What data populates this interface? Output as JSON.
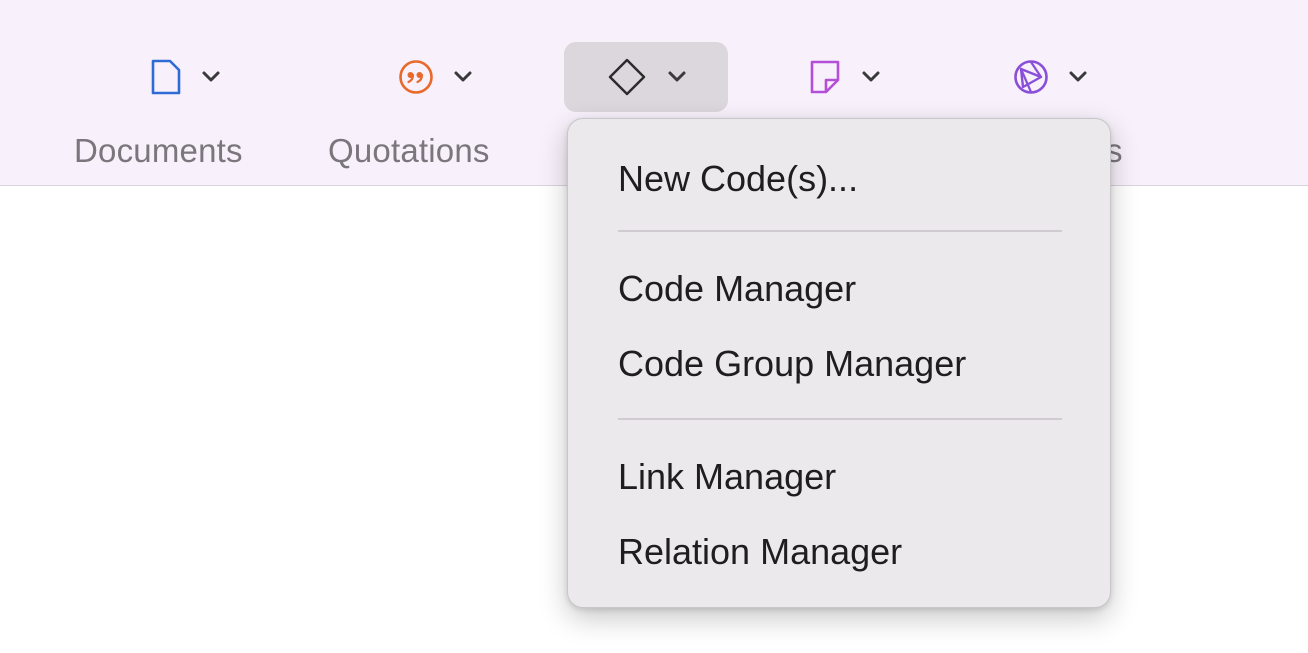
{
  "toolbar": {
    "documents": {
      "label": "Documents",
      "icon": "document-icon",
      "color": "#2f6bd6"
    },
    "quotations": {
      "label": "Quotations",
      "icon": "quotation-icon",
      "color": "#e8692a"
    },
    "codes": {
      "icon": "code-diamond-icon",
      "color": "#2b2b2b",
      "active": true
    },
    "memos": {
      "icon": "memo-icon",
      "color": "#b44fd8"
    },
    "networks": {
      "label_visible_tail": "s",
      "icon": "network-icon",
      "color": "#8a4fd8"
    }
  },
  "menu": {
    "items": [
      {
        "label": "New Code(s)..."
      },
      {
        "label": "Code Manager"
      },
      {
        "label": "Code Group Manager"
      },
      {
        "label": "Link Manager"
      },
      {
        "label": "Relation Manager"
      }
    ]
  },
  "colors": {
    "toolbar_bg": "#f8f0fa",
    "menu_bg": "#ebe9ec",
    "active_button_bg": "#dcd6dd",
    "label_text": "#7a767c",
    "menu_text": "#1e1e1f"
  }
}
